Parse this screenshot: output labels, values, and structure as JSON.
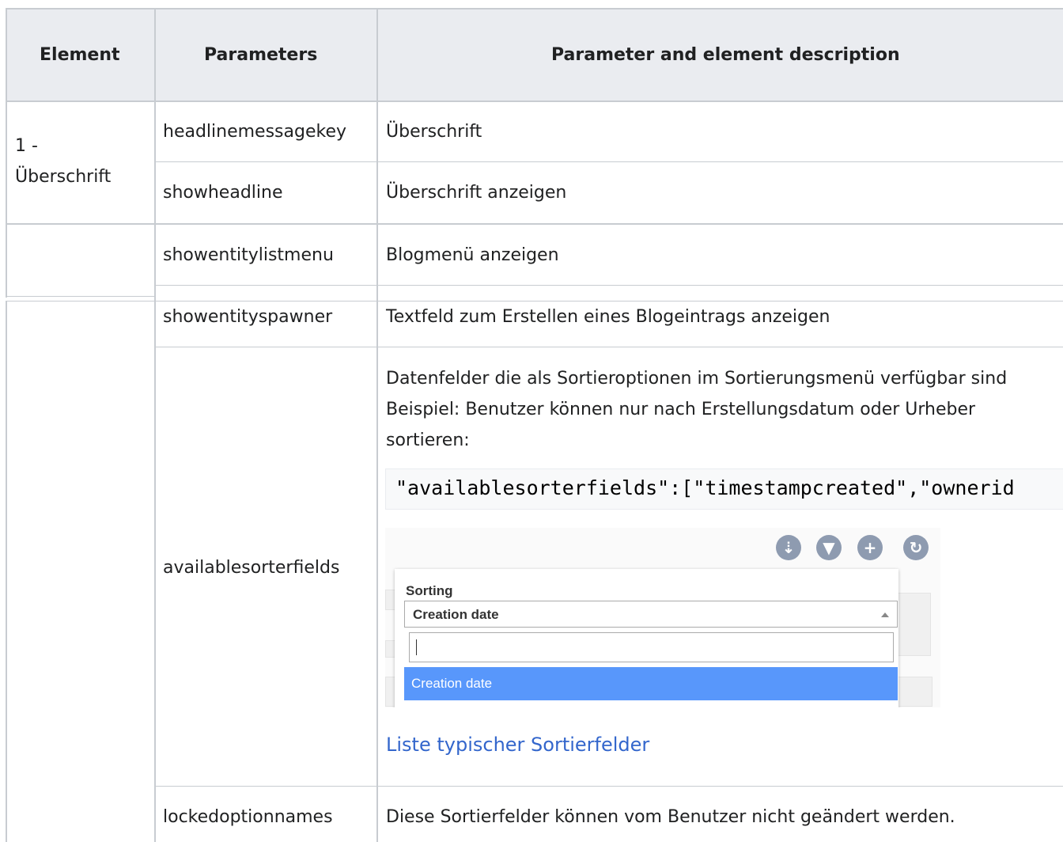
{
  "table": {
    "headers": [
      "Element",
      "Parameters",
      "Parameter and element description"
    ],
    "rows": [
      {
        "element": "1 -",
        "element_line2": "Überschrift",
        "param": "headlinemessagekey",
        "desc": "Überschrift"
      },
      {
        "param": "showheadline",
        "desc": "Überschrift anzeigen"
      },
      {
        "param": "showentitylistmenu",
        "desc": "Blogmenü anzeigen"
      },
      {
        "param": "showentityspawner",
        "desc": "Textfeld zum Erstellen eines Blogeintrags anzeigen"
      },
      {
        "param": "availablesorterfields",
        "desc_lines": [
          "Datenfelder die als Sortieroptionen im Sortierungsmenü verfügbar sind",
          "Beispiel: Benutzer können nur nach Erstellungsdatum oder Urheber",
          "sortieren:"
        ],
        "code": "\"availablesorterfields\":[\"timestampcreated\",\"ownerid",
        "link": "Liste typischer Sortierfelder"
      },
      {
        "param": "lockedoptionnames",
        "desc": "Diese Sortierfelder können vom Benutzer nicht geändert werden."
      }
    ]
  },
  "screenshot": {
    "icons": [
      "sort-icon",
      "filter-icon",
      "plus-icon",
      "refresh-icon"
    ],
    "label": "Sorting",
    "selected": "Creation date",
    "option": "Creation date",
    "colors": {
      "icon_bg": "#8e9bb0",
      "highlight": "#5897fb"
    }
  },
  "colors": {
    "header_bg": "#eaecf0",
    "border": "#c8ccd1",
    "link": "#3366cc"
  }
}
